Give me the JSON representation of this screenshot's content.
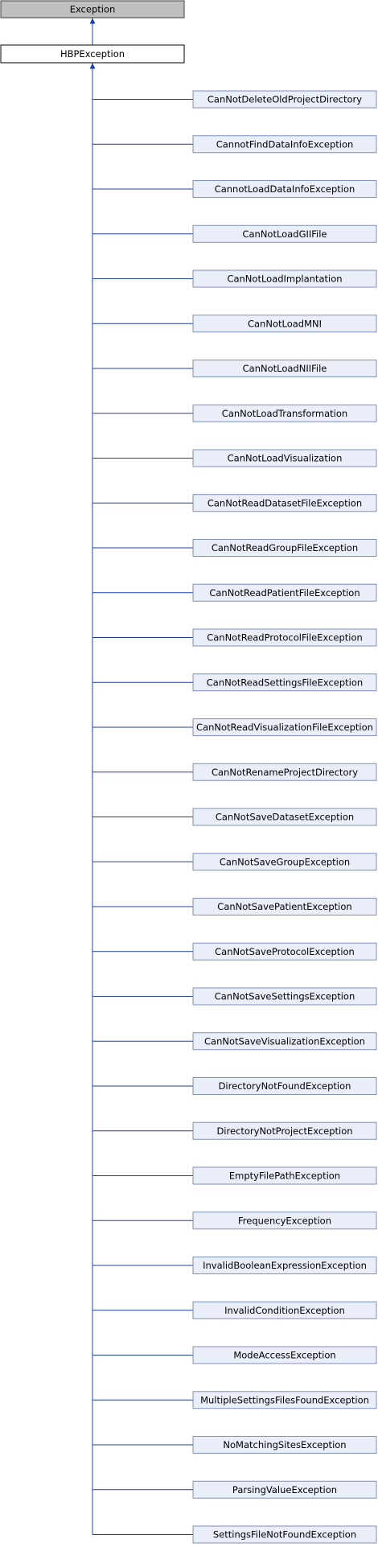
{
  "colors": {
    "root_fill": "#bfbfbf",
    "root_stroke": "#404040",
    "hbp_fill": "#ffffff",
    "hbp_stroke": "#000000",
    "child_fill": "#e9eef8",
    "child_stroke": "#7f8fbf",
    "edge": "#1f3fa4"
  },
  "diagram": {
    "root": "Exception",
    "base": "HBPException",
    "children": [
      "CanNotDeleteOldProjectDirectory",
      "CannotFindDataInfoException",
      "CannotLoadDataInfoException",
      "CanNotLoadGIIFile",
      "CanNotLoadImplantation",
      "CanNotLoadMNI",
      "CanNotLoadNIIFile",
      "CanNotLoadTransformation",
      "CanNotLoadVisualization",
      "CanNotReadDatasetFileException",
      "CanNotReadGroupFileException",
      "CanNotReadPatientFileException",
      "CanNotReadProtocolFileException",
      "CanNotReadSettingsFileException",
      "CanNotReadVisualizationFileException",
      "CanNotRenameProjectDirectory",
      "CanNotSaveDatasetException",
      "CanNotSaveGroupException",
      "CanNotSavePatientException",
      "CanNotSaveProtocolException",
      "CanNotSaveSettingsException",
      "CanNotSaveVisualizationException",
      "DirectoryNotFoundException",
      "DirectoryNotProjectException",
      "EmptyFilePathException",
      "FrequencyException",
      "InvalidBooleanExpressionException",
      "InvalidConditionException",
      "ModeAccessException",
      "MultipleSettingsFilesFoundException",
      "NoMatchingSitesException",
      "ParsingValueException",
      "SettingsFileNotFoundException"
    ]
  }
}
